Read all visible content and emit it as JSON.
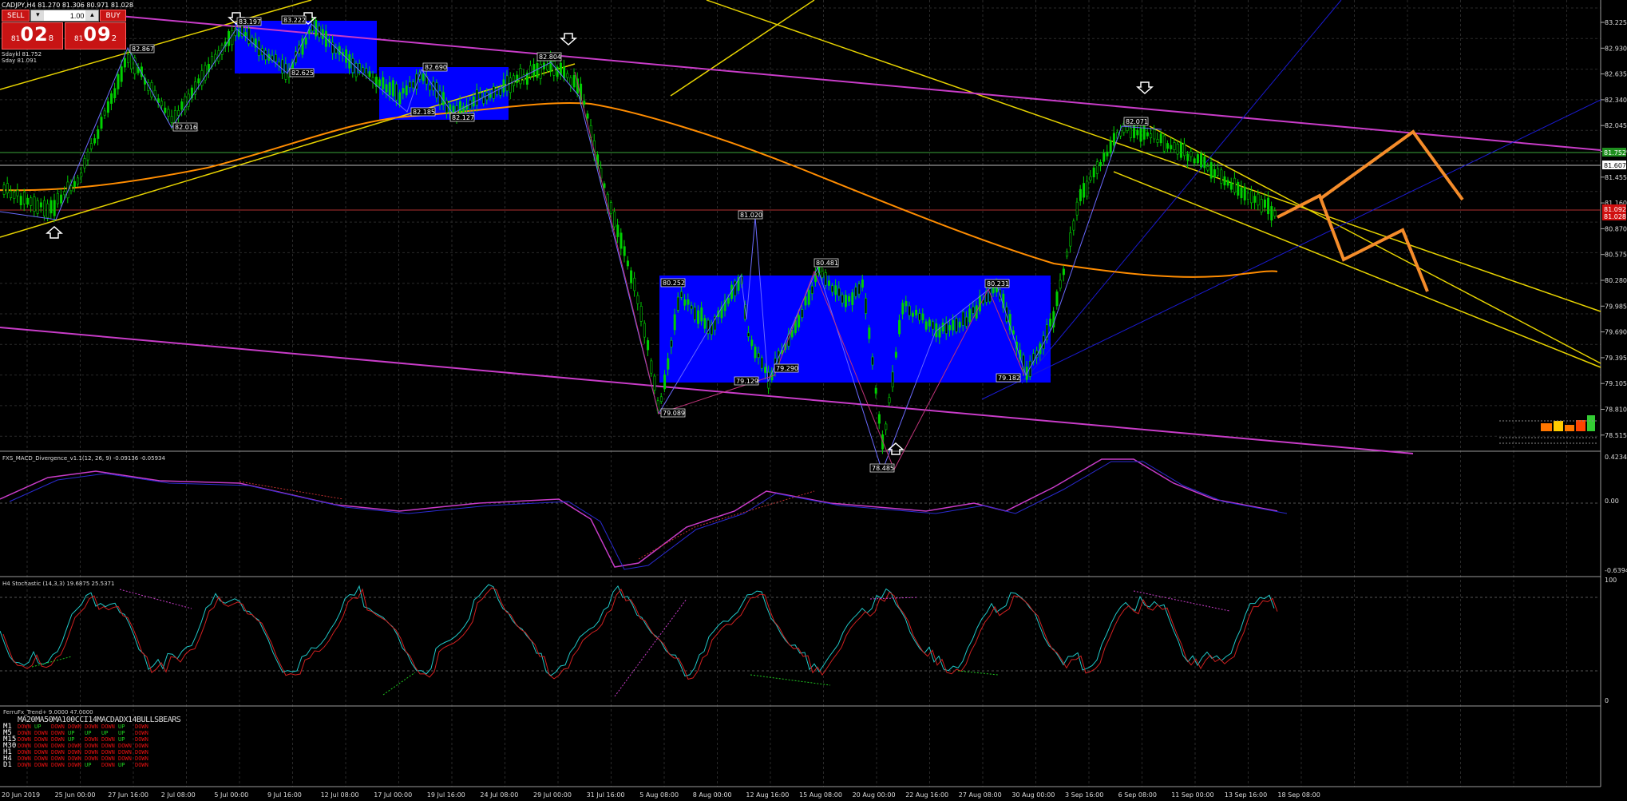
{
  "header": {
    "text": "CADJPY,H4  81.270 81.306 80.971 81.028"
  },
  "trade_panel": {
    "sell_label": "SELL",
    "buy_label": "BUY",
    "lot": "1.00",
    "sell_price": {
      "small": "81",
      "big": "02",
      "pip": "8"
    },
    "buy_price": {
      "small": "81",
      "big": "09",
      "pip": "2"
    }
  },
  "side_info": [
    "Sdaykl 81.752",
    "Sday  81.091"
  ],
  "price_axis": {
    "labels": [
      "83.225",
      "82.930",
      "82.635",
      "82.340",
      "82.045",
      "81.750",
      "81.455",
      "81.160",
      "80.870",
      "80.575",
      "80.280",
      "79.985",
      "79.690",
      "79.395",
      "79.105",
      "78.810",
      "78.515"
    ],
    "highlight_green": "81.752",
    "highlight_white": "81.607",
    "highlight_red": "81.092",
    "highlight_red2": "81.028"
  },
  "time_axis": [
    "20 Jun 2019",
    "25 Jun 00:00",
    "27 Jun 16:00",
    "2 Jul 08:00",
    "5 Jul 00:00",
    "9 Jul 16:00",
    "12 Jul 08:00",
    "17 Jul 00:00",
    "19 Jul 16:00",
    "24 Jul 08:00",
    "29 Jul 00:00",
    "31 Jul 16:00",
    "5 Aug 08:00",
    "8 Aug 00:00",
    "12 Aug 16:00",
    "15 Aug 08:00",
    "20 Aug 00:00",
    "22 Aug 16:00",
    "27 Aug 08:00",
    "30 Aug 00:00",
    "3 Sep 16:00",
    "6 Sep 08:00",
    "11 Sep 00:00",
    "13 Sep 16:00",
    "18 Sep 08:00"
  ],
  "price_labels": [
    "82.867",
    "83.197",
    "83.222",
    "82.625",
    "82.016",
    "82.690",
    "82.185",
    "82.127",
    "82.804",
    "81.020",
    "80.252",
    "80.481",
    "79.290",
    "79.089",
    "79.129",
    "80.231",
    "79.182",
    "78.485",
    "82.071"
  ],
  "indicators": {
    "macd": {
      "title": "FXS_MACD_Divergence_v1.1(12, 26, 9) -0.09136 -0.05934",
      "levels": [
        "0.42345",
        "0.00",
        "-0.63944"
      ]
    },
    "stoch": {
      "title": "H4 Stochastic (14,3,3) 19.6875 25.5371",
      "levels": [
        "100",
        "0"
      ]
    },
    "ferru": {
      "title": "FerruFx_Trend+ 9.0000 47.0000",
      "columns": "MA20MA50MA100CCI14MACDADX14BULLSBEARS",
      "rows": [
        {
          "tf": "M1",
          "vals": [
            "DOWN",
            "UP",
            "DOWN",
            "DOWN",
            "DOWN",
            "DOWN",
            "UP",
            "DOWN"
          ]
        },
        {
          "tf": "M5",
          "vals": [
            "DOWN",
            "DOWN",
            "DOWN",
            "UP",
            "UP",
            "UP",
            "UP",
            "DOWN"
          ]
        },
        {
          "tf": "M15",
          "vals": [
            "DOWN",
            "DOWN",
            "DOWN",
            "UP",
            "DOWN",
            "DOWN",
            "UP",
            "DOWN"
          ]
        },
        {
          "tf": "M30",
          "vals": [
            "DOWN",
            "DOWN",
            "DOWN",
            "DOWN",
            "DOWN",
            "DOWN",
            "DOWN",
            "DOWN"
          ]
        },
        {
          "tf": "H1",
          "vals": [
            "DOWN",
            "DOWN",
            "DOWN",
            "DOWN",
            "DOWN",
            "DOWN",
            "DOWN",
            "DOWN"
          ]
        },
        {
          "tf": "H4",
          "vals": [
            "DOWN",
            "DOWN",
            "DOWN",
            "DOWN",
            "DOWN",
            "DOWN",
            "DOWN",
            "DOWN"
          ]
        },
        {
          "tf": "D1",
          "vals": [
            "DOWN",
            "DOWN",
            "DOWN",
            "DOWN",
            "UP",
            "DOWN",
            "UP",
            "DOWN"
          ]
        }
      ]
    }
  },
  "colors": {
    "bull": "#00e000",
    "bear": "#00e000",
    "box": "#0000ff",
    "ma_orange": "#ff8c00",
    "magenta": "#c83cc8",
    "yellow": "#e6d200",
    "forecast": "#f58c2a"
  }
}
